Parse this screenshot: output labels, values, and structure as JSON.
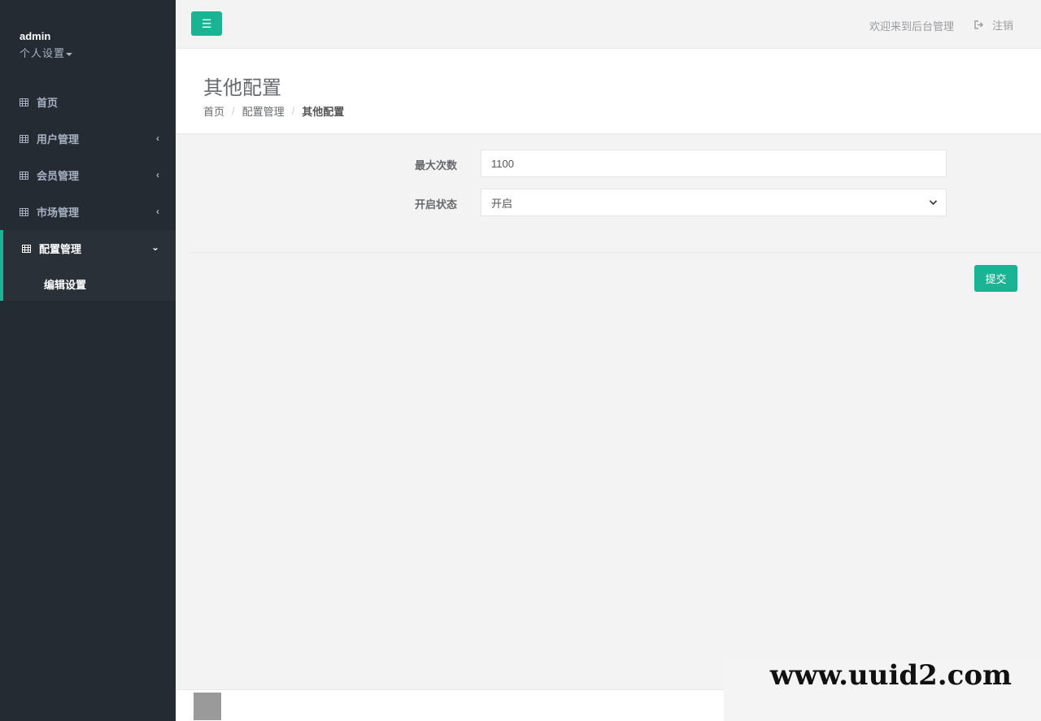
{
  "sidebar": {
    "user_name": "admin",
    "settings_label": "个人设置",
    "items": [
      {
        "label": "首页",
        "arrow": ""
      },
      {
        "label": "用户管理",
        "arrow": "‹"
      },
      {
        "label": "会员管理",
        "arrow": "‹"
      },
      {
        "label": "市场管理",
        "arrow": "‹"
      }
    ],
    "active_group": {
      "label": "配置管理",
      "arrow": "⌄",
      "sub_item": "编辑设置"
    }
  },
  "topbar": {
    "menu_icon": "☰",
    "welcome": "欢迎来到后台管理",
    "logout_label": "注销"
  },
  "heading": {
    "title": "其他配置",
    "breadcrumb": [
      "首页",
      "配置管理",
      "其他配置"
    ],
    "separator": "/"
  },
  "form": {
    "max_count_label": "最大次数",
    "max_count_value": "1100",
    "status_label": "开启状态",
    "status_value": "开启",
    "submit_label": "提交"
  },
  "watermark": "www.uuid2.com",
  "colors": {
    "accent": "#1ab394",
    "sidebar_bg": "#242b33",
    "page_bg": "#f3f3f4"
  }
}
